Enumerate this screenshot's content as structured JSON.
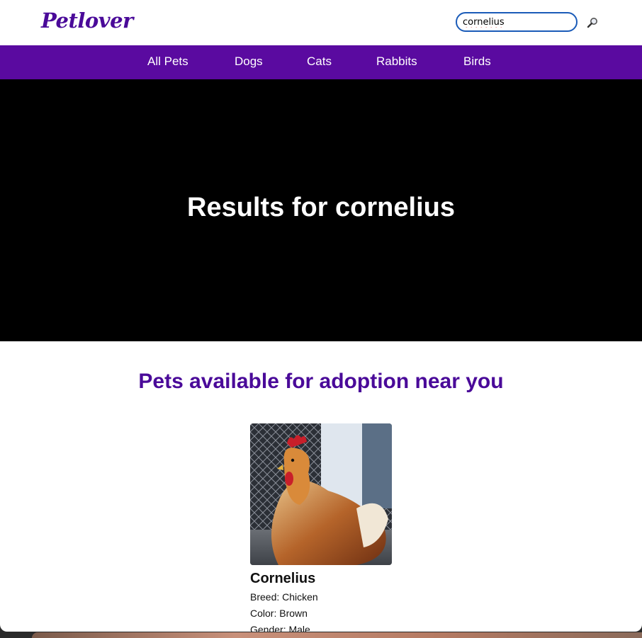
{
  "brand": {
    "logo_text": "Petlover",
    "accent": "#5a0aa0"
  },
  "search": {
    "value": "cornelius",
    "button_icon": "magnifier-icon"
  },
  "nav": {
    "items": [
      {
        "label": "All Pets"
      },
      {
        "label": "Dogs"
      },
      {
        "label": "Cats"
      },
      {
        "label": "Rabbits"
      },
      {
        "label": "Birds"
      }
    ]
  },
  "hero": {
    "title": "Results for cornelius"
  },
  "results": {
    "heading": "Pets available for adoption near you",
    "pets": [
      {
        "name": "Cornelius",
        "breed_line": "Breed: Chicken",
        "color_line": "Color: Brown",
        "gender_line": "Gender: Male"
      }
    ]
  }
}
